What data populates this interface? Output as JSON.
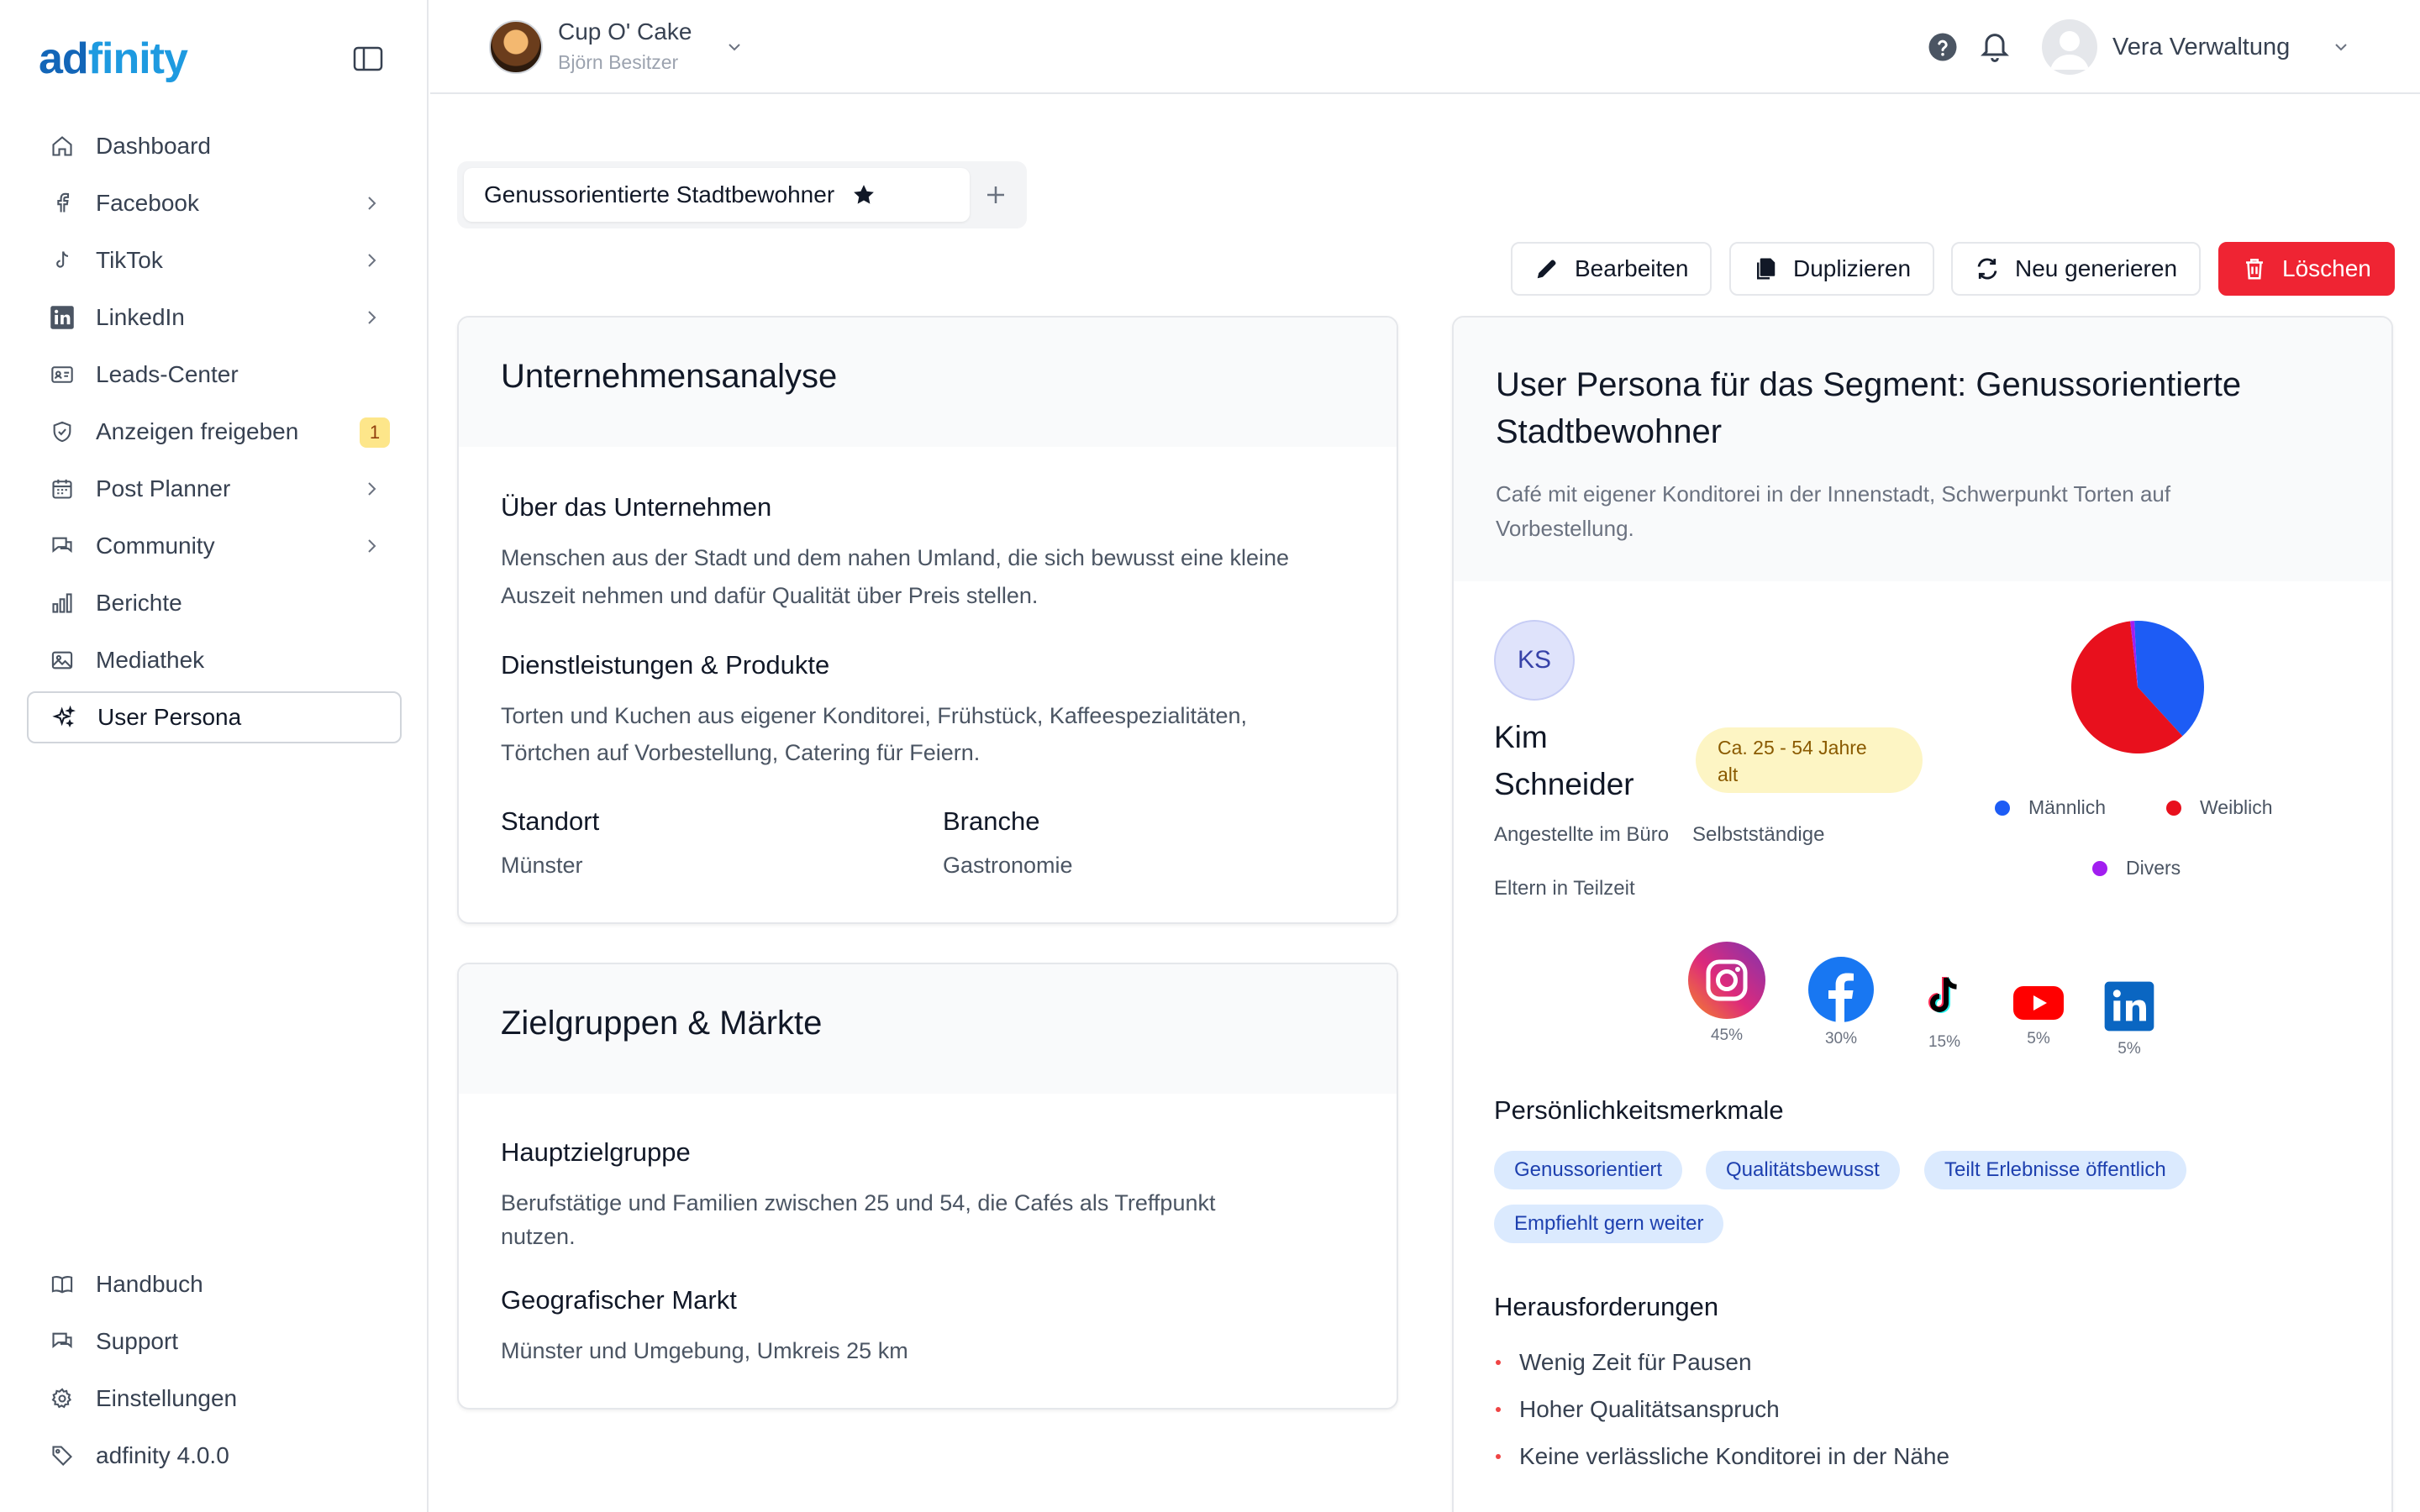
{
  "app": {
    "logo_prefix": "ad",
    "logo_suffix": "finity"
  },
  "sidebar": {
    "items": [
      {
        "label": "Dashboard",
        "icon": "home-icon"
      },
      {
        "label": "Facebook",
        "icon": "facebook-icon"
      },
      {
        "label": "TikTok",
        "icon": "tiktok-icon"
      },
      {
        "label": "LinkedIn",
        "icon": "linkedin-icon"
      },
      {
        "label": "Leads-Center",
        "icon": "id-card-icon"
      },
      {
        "label": "Anzeigen freigeben",
        "icon": "shield-check-icon",
        "badge": "1"
      },
      {
        "label": "Post Planner",
        "icon": "calendar-icon"
      },
      {
        "label": "Community",
        "icon": "chat-icon"
      },
      {
        "label": "Berichte",
        "icon": "bar-chart-icon"
      },
      {
        "label": "Mediathek",
        "icon": "image-icon"
      },
      {
        "label": "User Persona",
        "icon": "sparkles-icon",
        "active": true
      }
    ],
    "bottom": [
      {
        "label": "Handbuch",
        "icon": "book-icon"
      },
      {
        "label": "Support",
        "icon": "chat-icon"
      },
      {
        "label": "Einstellungen",
        "icon": "gear-icon"
      },
      {
        "label": "adfinity 4.0.0",
        "icon": "tag-icon"
      }
    ]
  },
  "header": {
    "brand_name": "Cup O' Cake",
    "brand_owner": "Björn Besitzer",
    "user_name": "Vera Verwaltung"
  },
  "tabs": {
    "active_label": "Genussorientierte Stadtbewohner"
  },
  "actions": {
    "edit": "Bearbeiten",
    "duplicate": "Duplizieren",
    "regenerate": "Neu generieren",
    "delete": "Löschen"
  },
  "company": {
    "title": "Unternehmensanalyse",
    "about_title": "Über das Unternehmen",
    "about_line1": "Menschen aus der Stadt und dem nahen Umland, die sich bewusst eine kleine",
    "about_line2": "Auszeit nehmen und dafür Qualität über Preis stellen.",
    "services_title": "Dienstleistungen & Produkte",
    "services_line1": "Torten und Kuchen aus eigener Konditorei, Frühstück, Kaffeespezialitäten,",
    "services_line2": "Törtchen auf Vorbestellung, Catering für Feiern.",
    "location_label": "Standort",
    "location_value": "Münster",
    "industry_label": "Branche",
    "industry_value": "Gastronomie"
  },
  "markets": {
    "title": "Zielgruppen & Märkte",
    "main_title": "Hauptzielgruppe",
    "main_line1": "Berufstätige und Familien zwischen 25 und 54, die Cafés als Treffpunkt",
    "main_line2": "nutzen.",
    "geo_title": "Geografischer Markt",
    "geo_text": "Münster und Umgebung, Umkreis 25 km"
  },
  "persona": {
    "title_line1": "User Persona für das Segment: Genussorientierte",
    "title_line2": "Stadtbewohner",
    "desc_line1": "Café mit eigener Konditorei in der Innenstadt, Schwerpunkt Torten auf",
    "desc_line2": "Vorbestellung.",
    "initials": "KS",
    "first_name": "Kim",
    "last_name": "Schneider",
    "age_line1": "Ca. 25 - 54 Jahre",
    "age_line2": "alt",
    "occupations": [
      "Angestellte im Büro",
      "Selbstständige",
      "Eltern in Teilzeit"
    ],
    "gender_legend": [
      {
        "label": "Männlich",
        "color": "#1d5cf5"
      },
      {
        "label": "Weiblich",
        "color": "#e8101d"
      },
      {
        "label": "Divers",
        "color": "#a21ef0"
      }
    ],
    "social": [
      {
        "name": "instagram-icon",
        "pct": "45%"
      },
      {
        "name": "facebook-icon",
        "pct": "30%"
      },
      {
        "name": "tiktok-icon",
        "pct": "15%"
      },
      {
        "name": "youtube-icon",
        "pct": "5%"
      },
      {
        "name": "linkedin-icon",
        "pct": "5%"
      }
    ],
    "traits_title": "Persönlichkeitsmerkmale",
    "traits": [
      "Genussorientiert",
      "Qualitätsbewusst",
      "Teilt Erlebnisse öffentlich",
      "Empfiehlt gern weiter"
    ],
    "challenges_title": "Herausforderungen",
    "challenges": [
      "Wenig Zeit für Pausen",
      "Hoher Qualitätsanspruch",
      "Keine verlässliche Konditorei in der Nähe"
    ]
  },
  "chart_data": {
    "type": "pie",
    "categories": [
      "Männlich",
      "Weiblich",
      "Divers"
    ],
    "values": [
      39,
      60,
      1
    ]
  }
}
